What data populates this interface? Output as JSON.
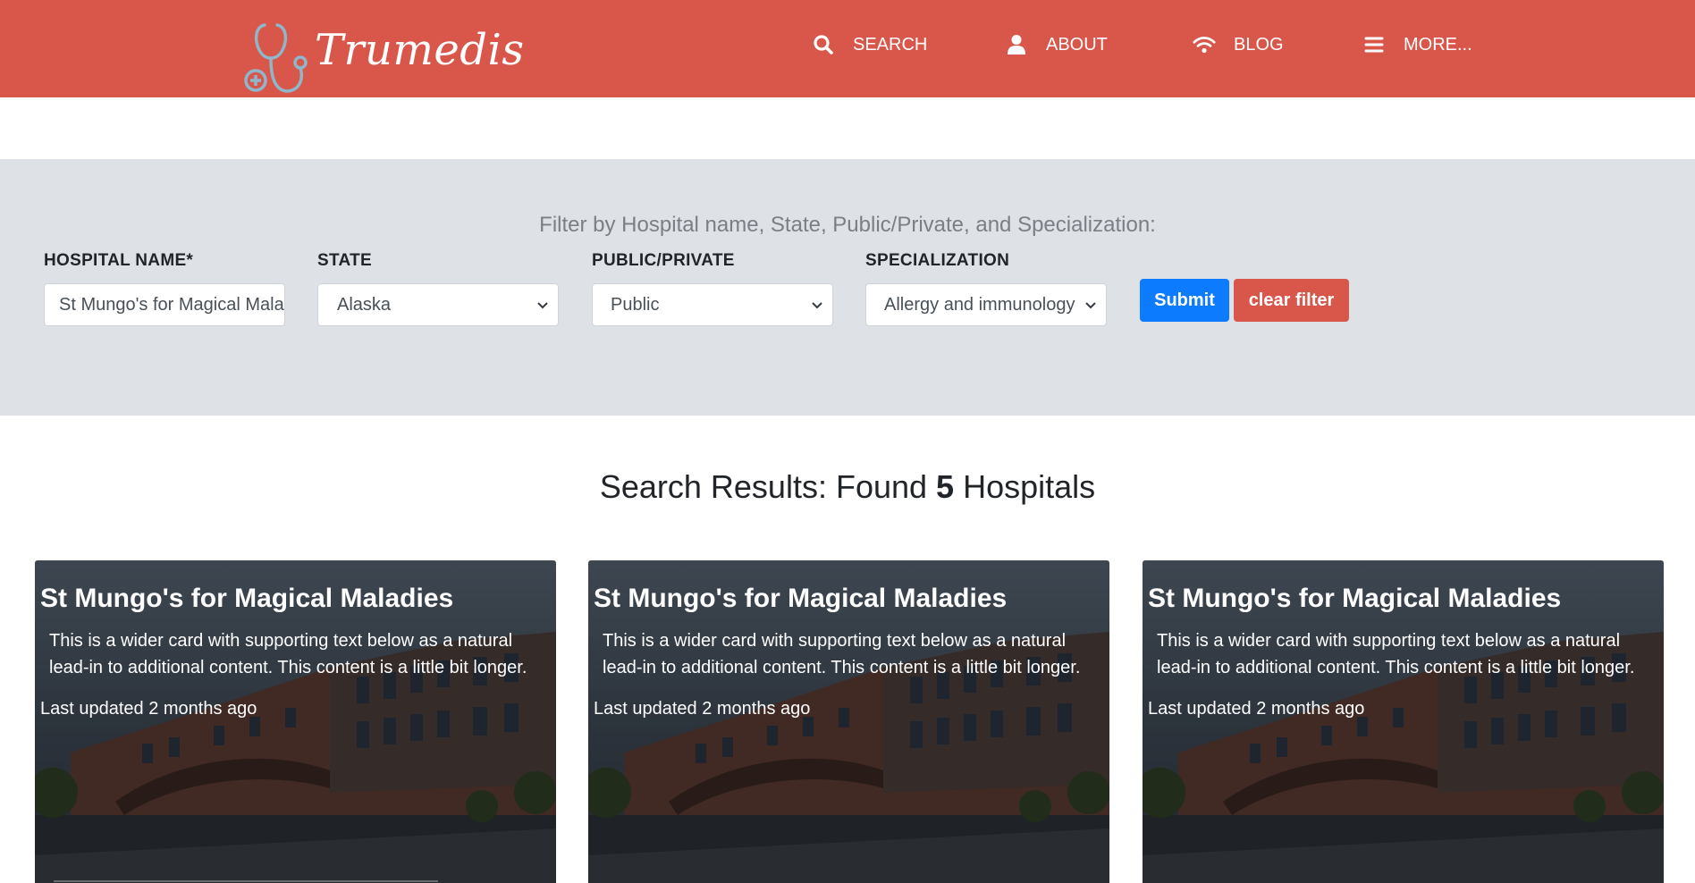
{
  "header": {
    "brand": "Trumedis",
    "nav": [
      {
        "label": "SEARCH",
        "icon": "search-icon"
      },
      {
        "label": "ABOUT",
        "icon": "user-icon"
      },
      {
        "label": "BLOG",
        "icon": "wifi-icon"
      },
      {
        "label": "MORE...",
        "icon": "menu-icon"
      }
    ]
  },
  "filter": {
    "title": "Filter by Hospital name, State, Public/Private, and Specialization:",
    "hospital_label": "HOSPITAL NAME*",
    "hospital_value": "St Mungo's for Magical Maladies",
    "state_label": "STATE",
    "state_value": "Alaska",
    "type_label": "PUBLIC/PRIVATE",
    "type_value": "Public",
    "specialization_label": "SPECIALIZATION",
    "specialization_value": "Allergy and immunology",
    "submit_label": "Submit",
    "clear_label": "clear filter"
  },
  "results": {
    "prefix": "Search Results: Found",
    "count": "5",
    "suffix": "Hospitals",
    "cards": [
      {
        "title": "St Mungo's for Magical Maladies",
        "text": "This is a wider card with supporting text below as a natural lead-in to additional content. This content is a little bit longer.",
        "updated": "Last updated 2 months ago"
      },
      {
        "title": "St Mungo's for Magical Maladies",
        "text": "This is a wider card with supporting text below as a natural lead-in to additional content. This content is a little bit longer.",
        "updated": "Last updated 2 months ago"
      },
      {
        "title": "St Mungo's for Magical Maladies",
        "text": "This is a wider card with supporting text below as a natural lead-in to additional content. This content is a little bit longer.",
        "updated": "Last updated 2 months ago"
      }
    ]
  },
  "colors": {
    "header": "#d9574a",
    "filter_band": "#dee1e6",
    "submit": "#0d7bfd",
    "clear": "#d9574a"
  }
}
